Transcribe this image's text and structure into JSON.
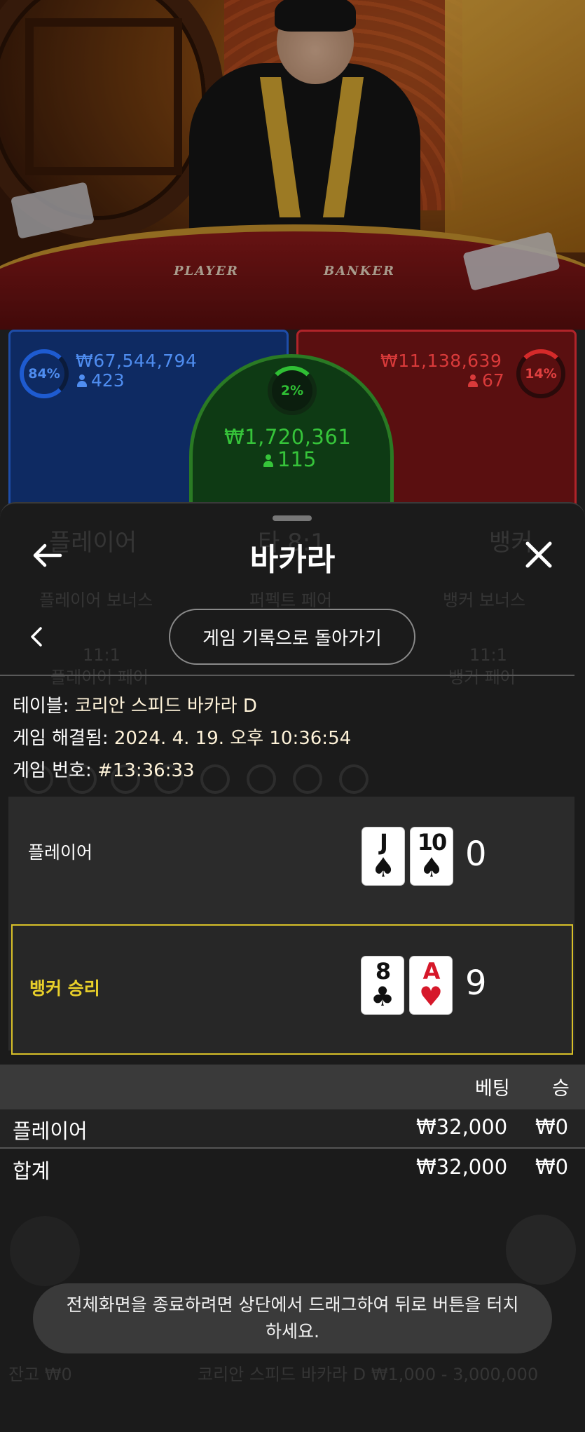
{
  "video": {
    "table_left_label": "PLAYER",
    "table_right_label": "BANKER"
  },
  "bets": {
    "player": {
      "percent": "84%",
      "amount": "₩67,544,794",
      "count": "423"
    },
    "banker": {
      "percent": "14%",
      "amount": "₩11,138,639",
      "count": "67"
    },
    "tie": {
      "percent": "2%",
      "amount": "₩1,720,361",
      "count": "115"
    }
  },
  "background_ghost": {
    "player": "플레이어",
    "tie": "타 8:1",
    "banker": "뱅커",
    "player_bonus": "플레이어 보너스",
    "either_pair": "퍼펙트 페어",
    "banker_bonus": "뱅커 보너스",
    "player_pair_odds": "11:1",
    "player_pair": "플레이어 페어",
    "banker_pair_odds": "11:1",
    "banker_pair": "뱅커 페어",
    "balance": "잔고 ₩0",
    "table_limits": "코리안 스피드 바카라 D ₩1,000 - 3,000,000"
  },
  "sheet": {
    "title": "바카라",
    "back_to_history": "게임 기록으로 돌아가기",
    "table_label": "테이블: ",
    "table_value": "코리안 스피드 바카라 D",
    "resolved_label": "게임 해결됨: ",
    "resolved_value": "2024. 4. 19. 오후 10:36:54",
    "game_no_label": "게임 번호: ",
    "game_no_value": "#13:36:33"
  },
  "result": {
    "player": {
      "label": "플레이어",
      "cards": [
        {
          "rank": "J",
          "suit": "♠",
          "color": "black"
        },
        {
          "rank": "10",
          "suit": "♠",
          "color": "black"
        }
      ],
      "score": "0"
    },
    "banker": {
      "label": "뱅커 승리",
      "cards": [
        {
          "rank": "8",
          "suit": "♣",
          "color": "black"
        },
        {
          "rank": "A",
          "suit": "♥",
          "color": "red"
        }
      ],
      "score": "9"
    }
  },
  "bets_table": {
    "headers": {
      "bet": "베팅",
      "win": "승"
    },
    "rows": [
      {
        "name": "플레이어",
        "bet": "₩32,000",
        "win": "₩0"
      },
      {
        "name": "합계",
        "bet": "₩32,000",
        "win": "₩0"
      }
    ]
  },
  "toast": "전체화면을 종료하려면 상단에서 드래그하여 뒤로 버튼을 터치하세요.",
  "colors": {
    "player_blue": "#1e4da8",
    "banker_red": "#b0242a",
    "tie_green": "#2a7a24",
    "winner_highlight": "#d8c028"
  }
}
